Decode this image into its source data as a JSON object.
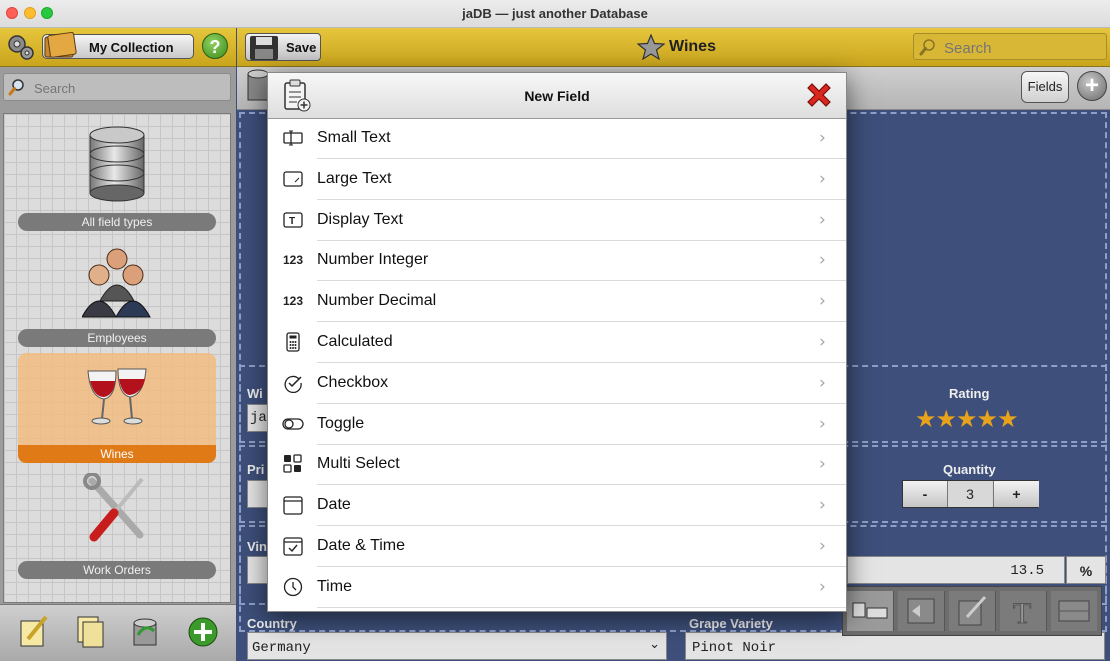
{
  "window": {
    "title": "jaDB — just another Database"
  },
  "sidebar": {
    "collection_label": "My Collection",
    "help_label": "?",
    "search_placeholder": "Search",
    "items": [
      {
        "label": "All field types"
      },
      {
        "label": "Employees"
      },
      {
        "label": "Wines"
      },
      {
        "label": "Work Orders"
      }
    ]
  },
  "toolbar": {
    "save_label": "Save",
    "db_title": "Wines",
    "search_placeholder": "Search",
    "fields_label": "Fields",
    "add_label": "+"
  },
  "form": {
    "wine_label_partial": "Wi",
    "wine_value_partial": "ja",
    "price_label_partial": "Pri",
    "vintage_label_partial": "Vin",
    "rating_label": "Rating",
    "rating_stars": 5,
    "rating_text": "★★★★★",
    "quantity_label": "Quantity",
    "quantity_minus": "-",
    "quantity_value": "3",
    "quantity_plus": "+",
    "alcohol_value": "13.5",
    "alcohol_unit": "%",
    "country_label": "Country",
    "country_value": "Germany",
    "grape_label": "Grape Variety",
    "grape_value": "Pinot Noir"
  },
  "dialog": {
    "title": "New Field",
    "field_types": [
      {
        "label": "Small Text",
        "icon": "small-text-icon"
      },
      {
        "label": "Large Text",
        "icon": "large-text-icon"
      },
      {
        "label": "Display Text",
        "icon": "display-text-icon"
      },
      {
        "label": "Number Integer",
        "icon": "number-icon",
        "icon_text": "123"
      },
      {
        "label": "Number Decimal",
        "icon": "number-icon",
        "icon_text": "123"
      },
      {
        "label": "Calculated",
        "icon": "calculator-icon"
      },
      {
        "label": "Checkbox",
        "icon": "checkmark-circle-icon"
      },
      {
        "label": "Toggle",
        "icon": "toggle-icon"
      },
      {
        "label": "Multi Select",
        "icon": "multi-select-icon"
      },
      {
        "label": "Date",
        "icon": "calendar-icon"
      },
      {
        "label": "Date & Time",
        "icon": "calendar-check-icon"
      },
      {
        "label": "Time",
        "icon": "clock-icon"
      }
    ]
  },
  "colors": {
    "toolbar_gold": "#d9b736",
    "sidebar_selected": "#f4ba7a",
    "selected_label": "#e07a17",
    "form_background": "#3d4f7a",
    "star_color": "#e8a21c"
  }
}
